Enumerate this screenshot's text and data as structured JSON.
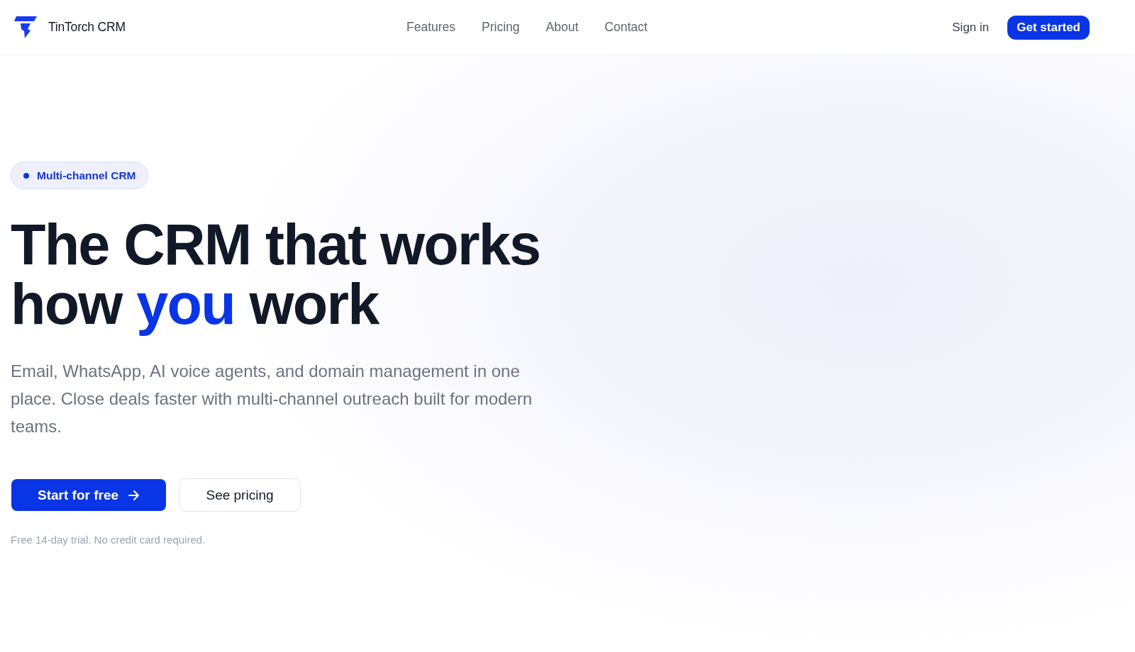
{
  "header": {
    "brand": "TinTorch CRM",
    "nav": [
      {
        "label": "Features"
      },
      {
        "label": "Pricing"
      },
      {
        "label": "About"
      },
      {
        "label": "Contact"
      }
    ],
    "sign_in": "Sign in",
    "cta": "Get started"
  },
  "hero": {
    "badge": "Multi-channel CRM",
    "heading": [
      {
        "text": "The CRM that works how ",
        "highlight": false
      },
      {
        "text": "you",
        "highlight": true
      },
      {
        "text": " work",
        "highlight": false
      }
    ],
    "description": "Email, WhatsApp, AI voice agents, and domain management in one place. Close deals faster with multi-channel outreach built for modern teams.",
    "buttons": [
      {
        "label": "Start for free",
        "kind": "primary"
      },
      {
        "label": "See pricing",
        "kind": "secondary"
      }
    ],
    "note": "Free 14-day trial. No credit card required."
  }
}
